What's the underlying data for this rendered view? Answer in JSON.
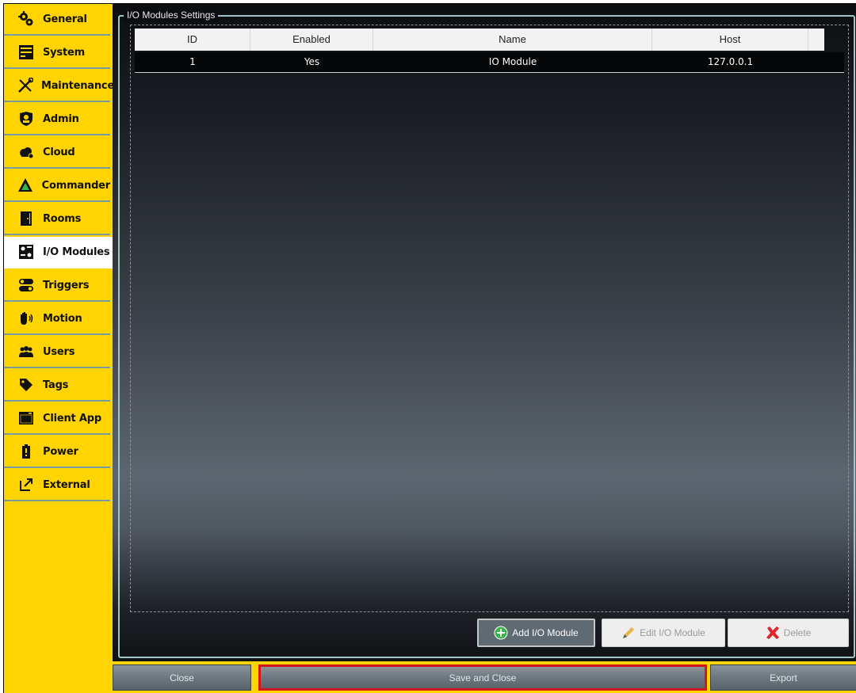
{
  "sidebar": {
    "items": [
      {
        "label": "General",
        "icon": "gears-icon"
      },
      {
        "label": "System",
        "icon": "server-icon"
      },
      {
        "label": "Maintenance",
        "icon": "tools-icon"
      },
      {
        "label": "Admin",
        "icon": "admin-shield-icon"
      },
      {
        "label": "Cloud",
        "icon": "cloud-icon"
      },
      {
        "label": "Commander",
        "icon": "commander-icon"
      },
      {
        "label": "Rooms",
        "icon": "door-icon"
      },
      {
        "label": "I/O Modules",
        "icon": "io-module-icon"
      },
      {
        "label": "Triggers",
        "icon": "toggle-icon"
      },
      {
        "label": "Motion",
        "icon": "motion-hand-icon"
      },
      {
        "label": "Users",
        "icon": "users-icon"
      },
      {
        "label": "Tags",
        "icon": "tag-icon"
      },
      {
        "label": "Client App",
        "icon": "window-icon"
      },
      {
        "label": "Power",
        "icon": "battery-icon"
      },
      {
        "label": "External",
        "icon": "external-link-icon"
      }
    ],
    "active_index": 7
  },
  "panel": {
    "title": "I/O Modules Settings"
  },
  "table": {
    "columns": [
      "ID",
      "Enabled",
      "Name",
      "Host"
    ],
    "rows": [
      {
        "id": "1",
        "enabled": "Yes",
        "name": "IO Module",
        "host": "127.0.0.1"
      }
    ]
  },
  "actions": {
    "add": "Add I/O Module",
    "edit": "Edit I/O Module",
    "delete": "Delete"
  },
  "footer": {
    "close": "Close",
    "save_and_close": "Save and Close",
    "export": "Export"
  },
  "colors": {
    "sidebar_bg": "#ffd400",
    "active_item_bg": "#ffffff",
    "panel_border": "#9fc6c8",
    "highlight_border": "#d4161c",
    "add_icon": "#3bb54a",
    "delete_icon": "#e0252a"
  }
}
